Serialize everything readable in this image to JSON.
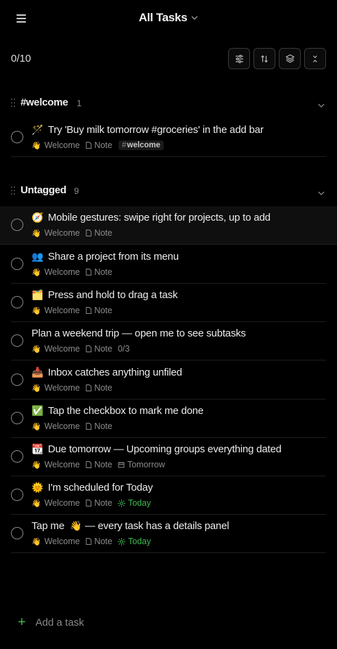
{
  "header": {
    "title": "All Tasks"
  },
  "summary": {
    "count": "0/10"
  },
  "sections": {
    "welcome": {
      "name": "#welcome",
      "count": "1"
    },
    "untagged": {
      "name": "Untagged",
      "count": "9"
    }
  },
  "common": {
    "project": "Welcome",
    "note": "Note",
    "hand_emoji": "👋"
  },
  "tasks": [
    {
      "emoji": "🪄",
      "title": "Try 'Buy milk tomorrow #groceries' in the add bar",
      "tag": "welcome"
    },
    {
      "emoji": "🧭",
      "title": "Mobile gestures: swipe right for projects, up to add"
    },
    {
      "emoji": "👥",
      "title": "Share a project from its menu"
    },
    {
      "emoji": "🗂️",
      "title": "Press and hold to drag a task"
    },
    {
      "emoji": "",
      "title": "Plan a weekend trip — open me to see subtasks",
      "subtasks": "0/3"
    },
    {
      "emoji": "📥",
      "title": "Inbox catches anything unfiled"
    },
    {
      "emoji": "✅",
      "title": "Tap the checkbox to mark me done"
    },
    {
      "emoji": "📆",
      "title": "Due tomorrow — Upcoming groups everything dated",
      "date": "Tomorrow"
    },
    {
      "emoji": "🌞",
      "title": "I'm scheduled for Today",
      "date": "Today"
    },
    {
      "title_pre": "Tap me",
      "emoji": "👋",
      "title": "— every task has a details panel",
      "date": "Today"
    }
  ],
  "footer": {
    "add_label": "Add a task"
  },
  "colors": {
    "accent": "#3fb950",
    "background": "#000000"
  }
}
